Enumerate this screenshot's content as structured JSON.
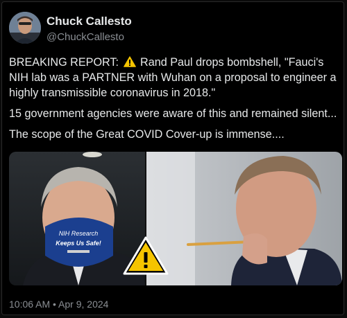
{
  "author": {
    "name": "Chuck Callesto",
    "handle": "@ChuckCallesto"
  },
  "post": {
    "line1_prefix": "BREAKING REPORT:",
    "line1_rest": "Rand Paul drops bombshell, \"Fauci's NIH lab was a PARTNER with Wuhan on a proposal to engineer a highly transmissible coronavirus in 2018.\"",
    "line2": "15 government agencies were aware of this and remained silent...",
    "line3": "The scope of the Great COVID Cover-up is immense...."
  },
  "media": {
    "mask_line1": "NIH Research",
    "mask_line2": "Keeps Us Safe!"
  },
  "meta": {
    "timestamp": "10:06 AM • Apr 9, 2024"
  },
  "colors": {
    "background": "#000000",
    "text": "#e7e9ea",
    "muted": "#8b8f94",
    "warning_yellow": "#f5c400",
    "mask_blue": "#1b3f8f"
  },
  "icons": [
    "warning-icon",
    "warning-sign-icon"
  ]
}
